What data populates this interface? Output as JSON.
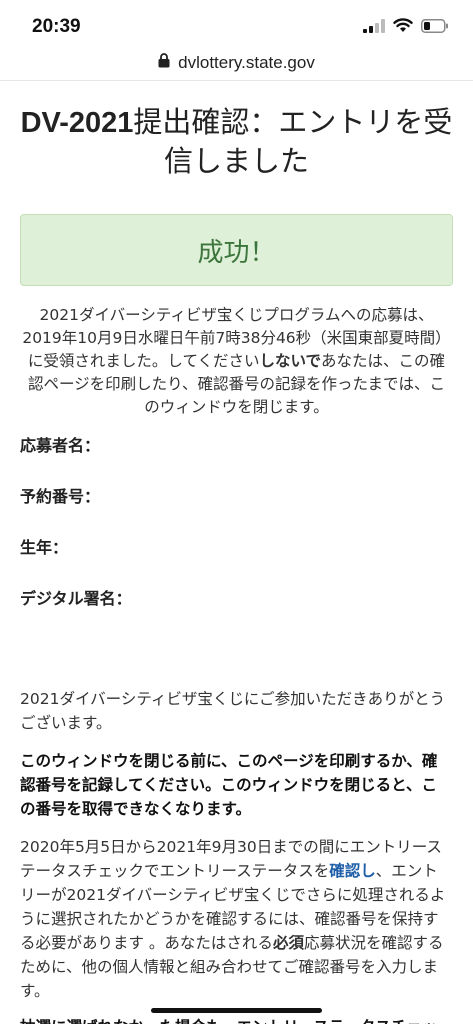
{
  "status_bar": {
    "time": "20:39"
  },
  "browser": {
    "url": "dvlottery.state.gov"
  },
  "page": {
    "title_prefix": "DV-2021",
    "title_rest": "提出確認：エントリを受信しました",
    "success_text": "成功！",
    "receipt_part1": "2021ダイバーシティビザ宝くじプログラムへの応募は、2019年10月9日水曜日午前7時38分46秒（米国東部夏時間）に受領されました。してください",
    "receipt_bold": "しないで",
    "receipt_part2": "あなたは、この確認ページを印刷したり、確認番号の記録を作ったまでは、このウィンドウを閉じます。",
    "fields": {
      "applicant_name": "応募者名：",
      "confirmation_number": "予約番号：",
      "birth_year": "生年：",
      "digital_signature": "デジタル署名："
    },
    "thanks": "2021ダイバーシティビザ宝くじにご参加いただきありがとうございます。",
    "warning": "このウィンドウを閉じる前に、このページを印刷するか、確認番号を記録してください。このウィンドウを閉じると、この番号を取得できなくなります。",
    "status_para_part1": "2020年5月5日から2021年9月30日までの間にエントリーステータスチェックでエントリーステータスを",
    "status_link": "確認し",
    "status_para_part2": "、エントリーが2021ダイバーシティビザ宝くじでさらに処理されるように選択されたかどうかを確認するには、確認番号を保持する必要があります 。あなたはされる",
    "status_bold": "必須",
    "status_para_part3": "応募状況を確認するために、他の個人情報と組み合わせてご確認番号を入力します。",
    "cutoff_line": "抽選に選ばれなかった場合も、エントリーステータスチェックで確認できます。"
  }
}
